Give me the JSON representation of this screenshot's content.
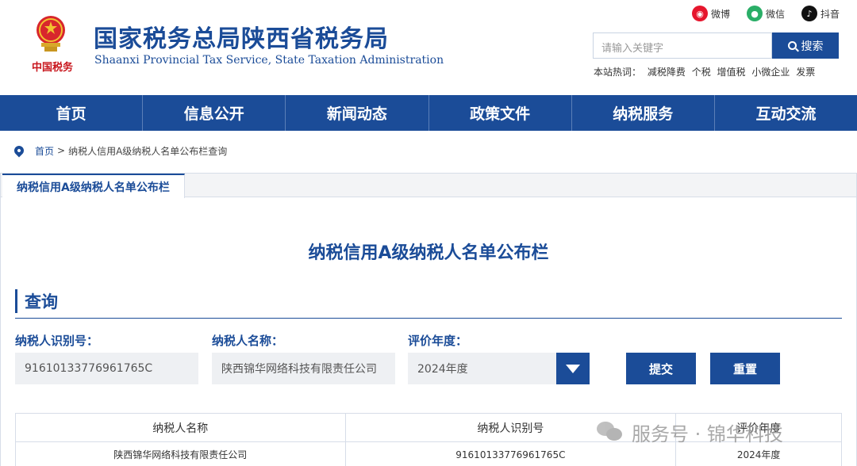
{
  "header": {
    "title_cn": "国家税务总局陕西省税务局",
    "title_en": "Shaanxi Provincial Tax Service, State Taxation Administration",
    "logo_script": "中国税务",
    "social": [
      {
        "label": "微博",
        "icon": "weibo-icon"
      },
      {
        "label": "微信",
        "icon": "wechat-icon"
      },
      {
        "label": "抖音",
        "icon": "douyin-icon"
      }
    ],
    "search": {
      "placeholder": "请输入关键字",
      "button_label": "搜索"
    },
    "hot": {
      "label": "本站热词：",
      "items": [
        "减税降费",
        "个税",
        "增值税",
        "小微企业",
        "发票"
      ]
    }
  },
  "nav": {
    "items": [
      "首页",
      "信息公开",
      "新闻动态",
      "政策文件",
      "纳税服务",
      "互动交流"
    ]
  },
  "breadcrumb": {
    "home": "首页",
    "separator": ">",
    "current": "纳税人信用A级纳税人名单公布栏查询"
  },
  "tab": {
    "label": "纳税信用A级纳税人名单公布栏"
  },
  "panel": {
    "title": "纳税信用A级纳税人名单公布栏"
  },
  "query": {
    "heading": "查询",
    "fields": {
      "taxpayer_id": {
        "label": "纳税人识别号：",
        "value": "91610133776961765C"
      },
      "taxpayer_name": {
        "label": "纳税人名称：",
        "value": "陕西锦华网络科技有限责任公司"
      },
      "year": {
        "label": "评价年度：",
        "value": "2024年度"
      }
    },
    "submit_label": "提交",
    "reset_label": "重置"
  },
  "table": {
    "headers": [
      "纳税人名称",
      "纳税人识别号",
      "评价年度"
    ],
    "rows": [
      [
        "陕西锦华网络科技有限责任公司",
        "91610133776961765C",
        "2024年度"
      ]
    ]
  },
  "watermark": {
    "text": "服务号 · 锦华科技"
  },
  "colors": {
    "primary": "#1b4c98",
    "weibo": "#e6162d",
    "wechat": "#2aae67",
    "douyin": "#111111"
  }
}
